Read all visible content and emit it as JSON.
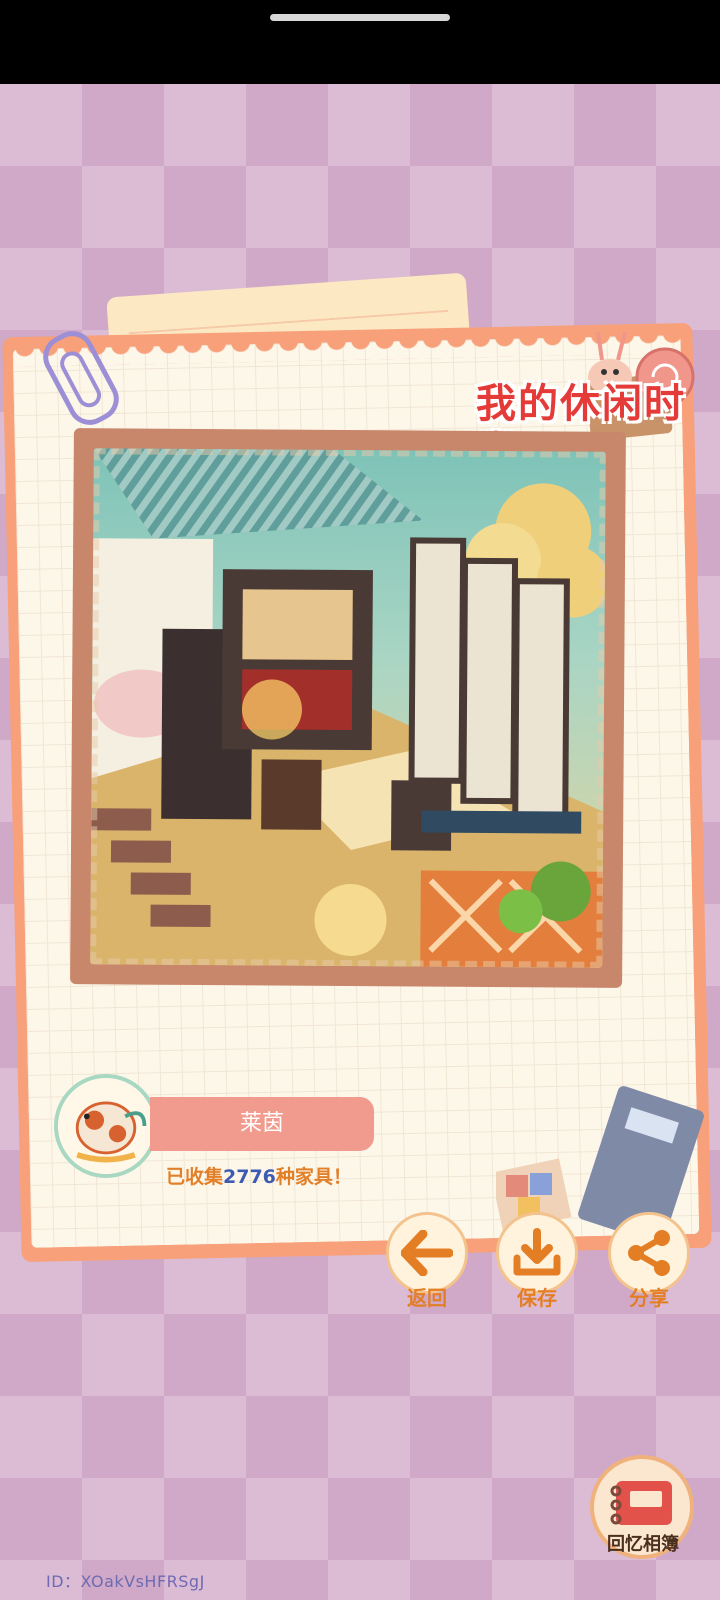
{
  "logo": {
    "text": "我的休闲时光"
  },
  "profile": {
    "name": "莱茵",
    "collected_prefix": "已收集",
    "collected_count": "2776",
    "collected_suffix": "种家具！"
  },
  "actions": [
    {
      "label": "返回",
      "icon": "arrow-left-icon"
    },
    {
      "label": "保存",
      "icon": "download-icon"
    },
    {
      "label": "分享",
      "icon": "share-icon"
    }
  ],
  "album": {
    "label": "回忆相簿",
    "icon": "album-icon"
  },
  "user_id": "ID：XOakVsHFRSgJ",
  "colors": {
    "accent": "#e47e25",
    "pill": "#f09b8e",
    "count": "#3d5bb3"
  }
}
